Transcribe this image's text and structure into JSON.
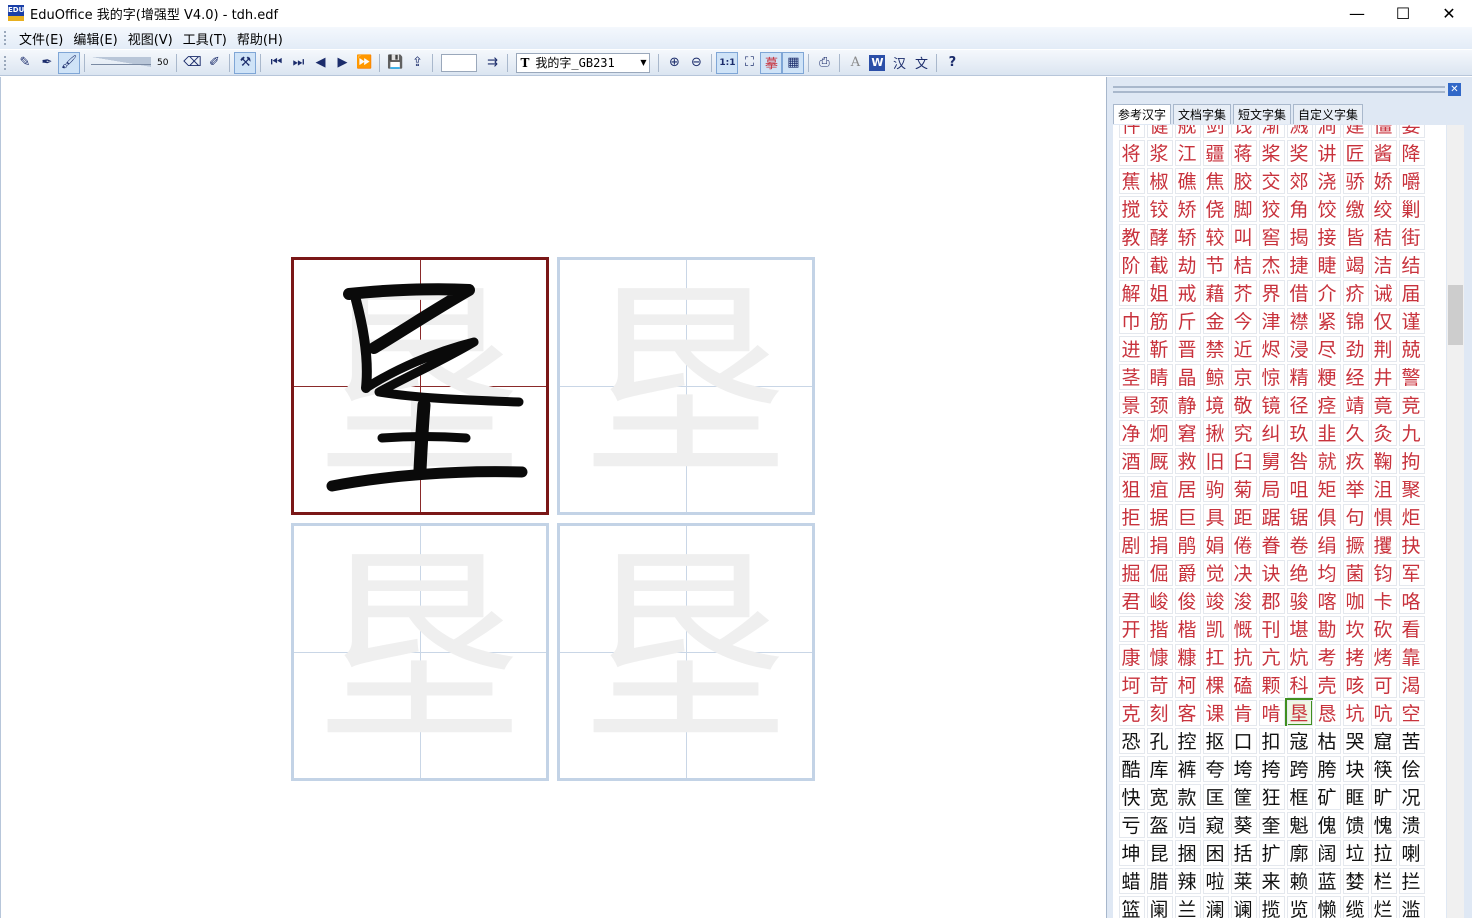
{
  "window": {
    "title": "EduOffice 我的字(增强型 V4.0) - tdh.edf",
    "icon_text": "EDU",
    "controls": {
      "minimize": "—",
      "maximize": "☐",
      "close": "✕"
    }
  },
  "menu": [
    "文件(E)",
    "编辑(E)",
    "视图(V)",
    "工具(T)",
    "帮助(H)"
  ],
  "toolbar": {
    "pen_width_value": "50",
    "font_select_label": "我的字_GB231",
    "font_icon": "T",
    "buttons": [
      {
        "icon": "pencil-icon",
        "glyph": "✎"
      },
      {
        "icon": "pen-icon",
        "glyph": "✒"
      },
      {
        "icon": "brush-icon",
        "glyph": "🖌"
      },
      {
        "icon": "eraser-icon",
        "glyph": "⌫"
      },
      {
        "icon": "clear-icon",
        "glyph": "✐"
      },
      {
        "icon": "tools-icon",
        "glyph": "⚒"
      },
      {
        "icon": "first-page-icon",
        "glyph": "⏮"
      },
      {
        "icon": "last-page-icon",
        "glyph": "⏭"
      },
      {
        "icon": "prev-icon",
        "glyph": "◀"
      },
      {
        "icon": "next-icon",
        "glyph": "▶"
      },
      {
        "icon": "fast-forward-icon",
        "glyph": "⏩"
      },
      {
        "icon": "save-icon",
        "glyph": "💾"
      },
      {
        "icon": "export-icon",
        "glyph": "⇪"
      },
      {
        "icon": "zoom-in-icon",
        "glyph": "🔍"
      },
      {
        "icon": "zoom-out-icon",
        "glyph": "🔎"
      },
      {
        "icon": "actual-size-icon",
        "glyph": "1:1"
      },
      {
        "icon": "fit-icon",
        "glyph": "⛶"
      },
      {
        "icon": "copy-mode-icon",
        "glyph": "摹"
      },
      {
        "icon": "layout-icon",
        "glyph": "▦"
      },
      {
        "icon": "page-setup-icon",
        "glyph": "⎙"
      },
      {
        "icon": "font-a-icon",
        "glyph": "A"
      },
      {
        "icon": "word-icon",
        "glyph": "W"
      },
      {
        "icon": "hanzi-icon",
        "glyph": "汉"
      },
      {
        "icon": "wen-icon",
        "glyph": "文"
      },
      {
        "icon": "help-icon",
        "glyph": "?"
      }
    ]
  },
  "canvas": {
    "current_char": "垦"
  },
  "panel": {
    "tabs": [
      "参考汉字",
      "文档字集",
      "短文字集",
      "自定义字集"
    ],
    "active_tab": 0,
    "selected_char": "垦",
    "red_rows": [
      "件健舰剑饯渐溅涧建僵姜",
      "将浆江疆蒋桨奖讲匠酱降",
      "蕉椒礁焦胶交郊浇骄娇嚼",
      "搅铰矫侥脚狡角饺缴绞剿",
      "教酵轿较叫窖揭接皆秸街",
      "阶截劫节桔杰捷睫竭洁结",
      "解姐戒藉芥界借介疥诫届",
      "巾筋斤金今津襟紧锦仅谨",
      "进靳晋禁近烬浸尽劲荆兢",
      "茎睛晶鲸京惊精粳经井警",
      "景颈静境敬镜径痉靖竟竞",
      "净炯窘揪究纠玖韭久灸九",
      "酒厩救旧臼舅咎就疚鞠拘",
      "狙疽居驹菊局咀矩举沮聚",
      "拒据巨具距踞锯俱句惧炬",
      "剧捐鹃娟倦眷卷绢撅攫抉",
      "掘倔爵觉决诀绝均菌钧军",
      "君峻俊竣浚郡骏喀咖卡咯",
      "开揩楷凯慨刊堪勘坎砍看",
      "康慷糠扛抗亢炕考拷烤靠",
      "坷苛柯棵磕颗科壳咳可渴",
      "克刻客课肯啃垦恳坑吭空"
    ],
    "black_rows": [
      "恐孔控抠口扣寇枯哭窟苦",
      "酷库裤夸垮挎跨胯块筷侩",
      "快宽款匡筐狂框矿眶旷况",
      "亏盔岿窥葵奎魁傀馈愧溃",
      "坤昆捆困括扩廓阔垃拉喇",
      "蜡腊辣啦莱来赖蓝婪栏拦",
      "篮阑兰澜谰揽览懒缆烂滥"
    ]
  }
}
